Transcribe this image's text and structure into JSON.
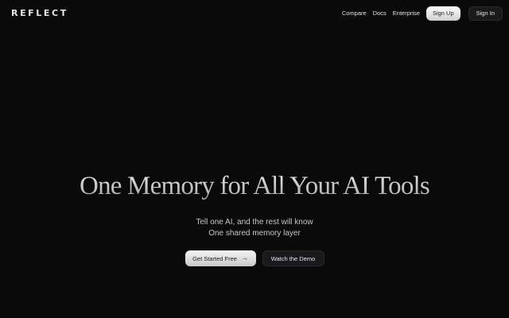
{
  "brand": {
    "logo_text": "REFLECT"
  },
  "nav": {
    "links": [
      "Compare",
      "Docs",
      "Enterprise"
    ],
    "signup_label": "Sign Up",
    "signin_label": "Sign In"
  },
  "hero": {
    "headline": "One Memory for All Your AI Tools",
    "subline_1": "Tell one AI, and the rest will know",
    "subline_2": "One shared memory layer",
    "primary_cta": "Get Started Free",
    "primary_cta_icon": "arrow-right-icon",
    "secondary_cta": "Watch the Demo"
  },
  "colors": {
    "background": "#0a0a0b",
    "primary_button": "#e6e6e6",
    "secondary_button": "#1a1a1c"
  }
}
